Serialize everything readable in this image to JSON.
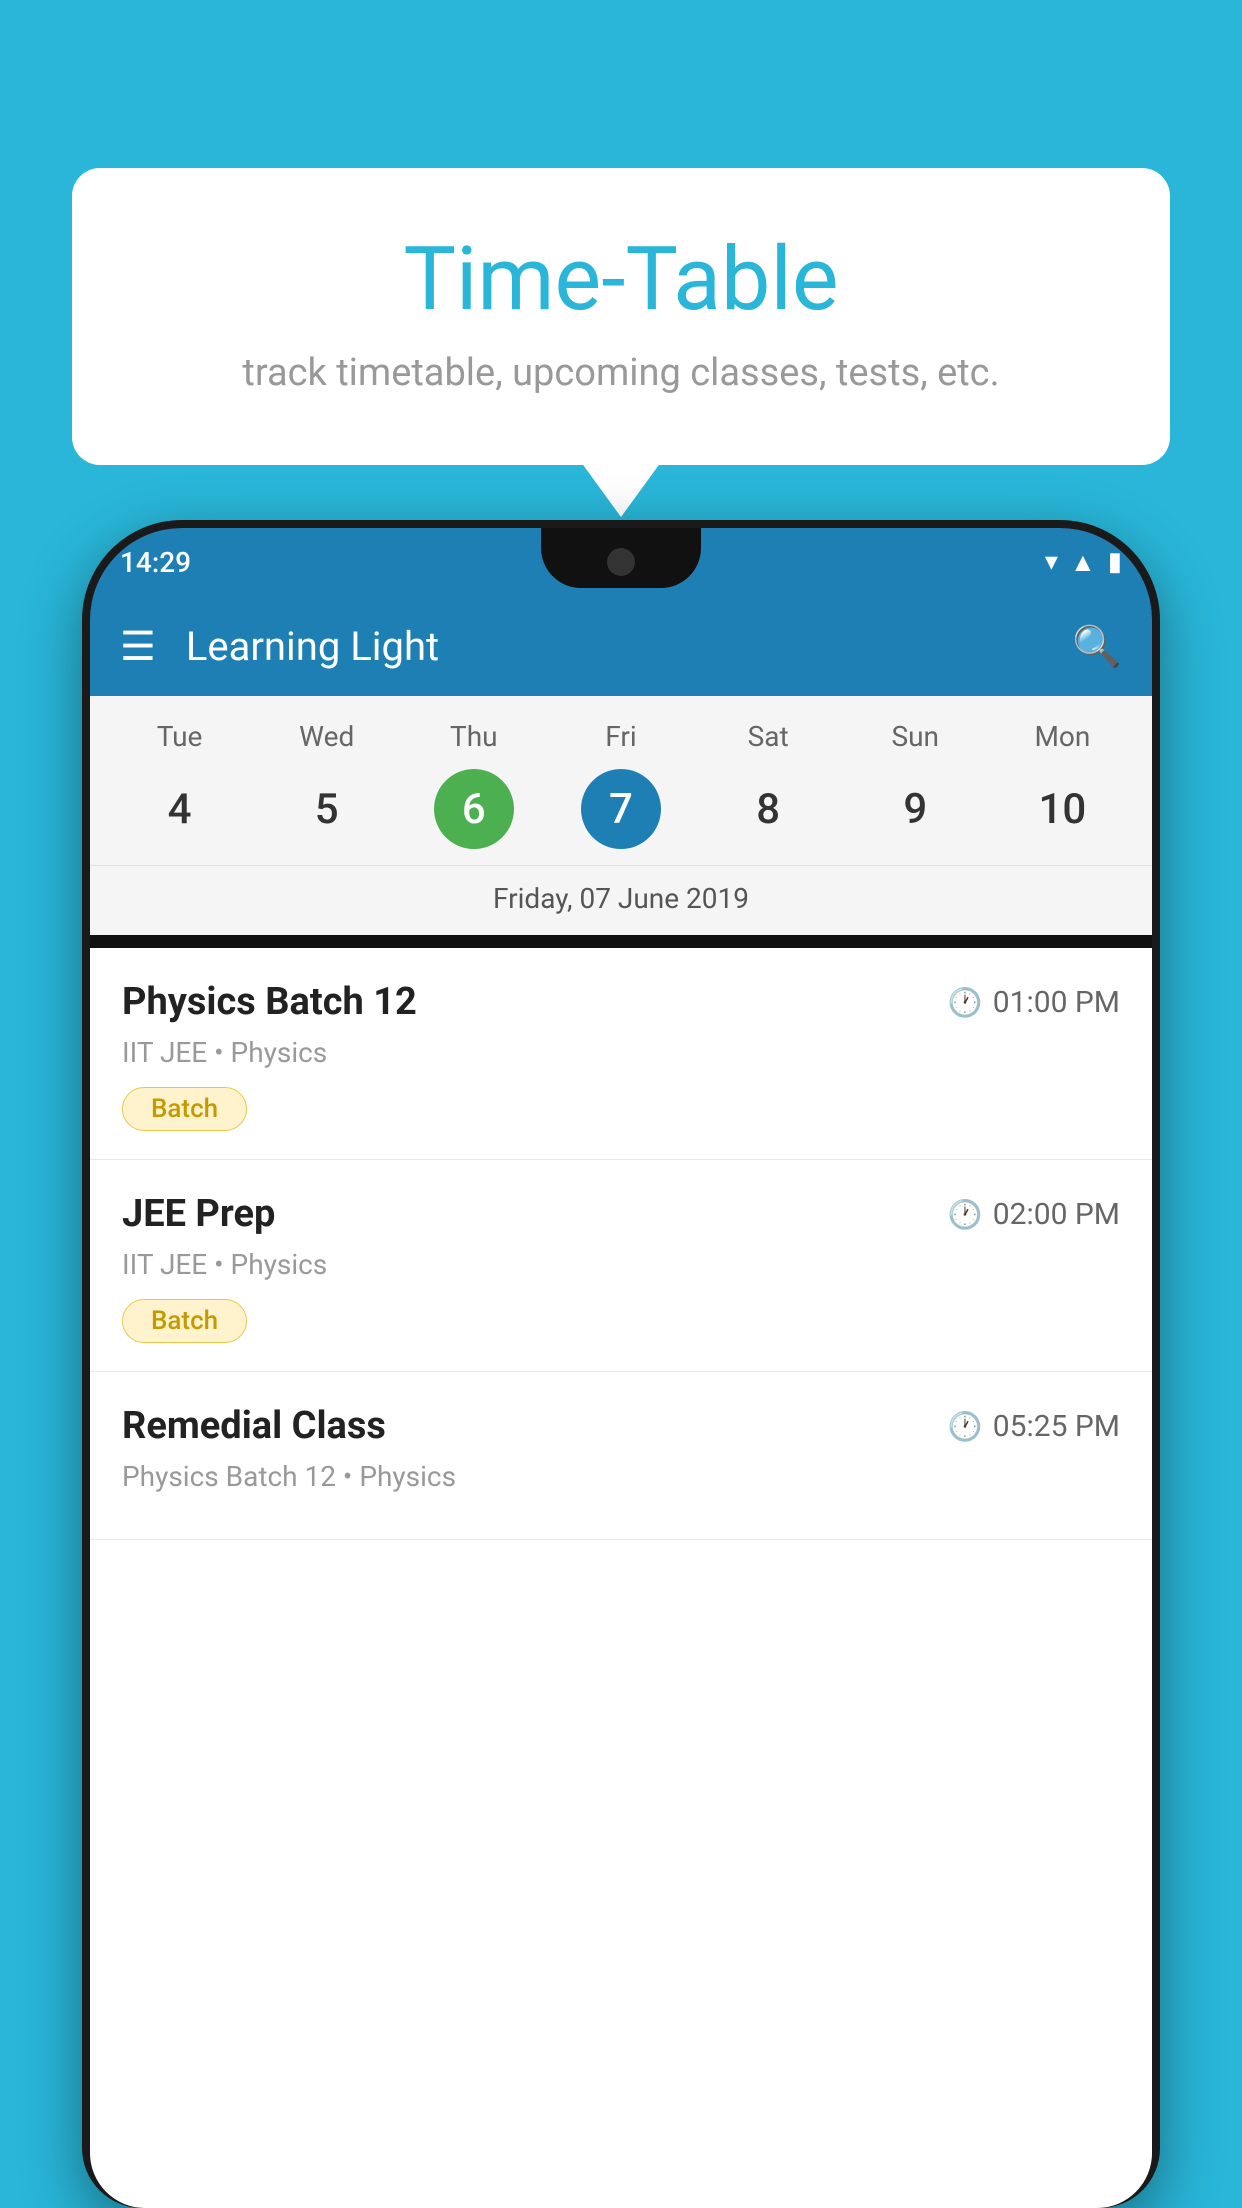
{
  "background": {
    "color": "#29B6D8"
  },
  "speech_bubble": {
    "title": "Time-Table",
    "subtitle": "track timetable, upcoming classes, tests, etc."
  },
  "app_bar": {
    "title": "Learning Light"
  },
  "status_bar": {
    "time": "14:29"
  },
  "calendar": {
    "days": [
      {
        "name": "Tue",
        "num": "4",
        "state": "normal"
      },
      {
        "name": "Wed",
        "num": "5",
        "state": "normal"
      },
      {
        "name": "Thu",
        "num": "6",
        "state": "today"
      },
      {
        "name": "Fri",
        "num": "7",
        "state": "selected"
      },
      {
        "name": "Sat",
        "num": "8",
        "state": "normal"
      },
      {
        "name": "Sun",
        "num": "9",
        "state": "normal"
      },
      {
        "name": "Mon",
        "num": "10",
        "state": "normal"
      }
    ],
    "selected_date_label": "Friday, 07 June 2019"
  },
  "schedule": {
    "items": [
      {
        "title": "Physics Batch 12",
        "time": "01:00 PM",
        "subtitle": "IIT JEE • Physics",
        "badge": "Batch"
      },
      {
        "title": "JEE Prep",
        "time": "02:00 PM",
        "subtitle": "IIT JEE • Physics",
        "badge": "Batch"
      },
      {
        "title": "Remedial Class",
        "time": "05:25 PM",
        "subtitle": "Physics Batch 12 • Physics",
        "badge": null
      }
    ]
  }
}
